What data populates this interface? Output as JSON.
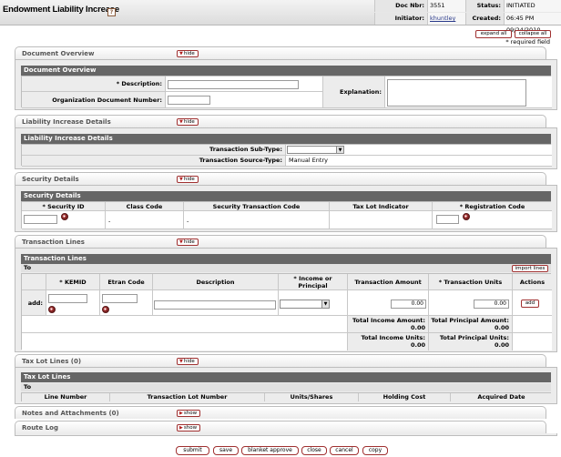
{
  "header": {
    "title": "Endowment Liability Increase",
    "help": "?",
    "doc_nbr_label": "Doc Nbr:",
    "doc_nbr": "3551",
    "status_label": "Status:",
    "status": "INITIATED",
    "initiator_label": "Initiator:",
    "initiator": "khuntley",
    "created_label": "Created:",
    "created": "06:45 PM 09/24/2010"
  },
  "actions": {
    "expand_all": "expand all",
    "collapse_all": "collapse all",
    "required_note": "* required field"
  },
  "document_overview": {
    "tab": "Document Overview",
    "toggle": "hide",
    "subheader": "Document Overview",
    "description_label": "* Description:",
    "org_doc_number_label": "Organization Document Number:",
    "explanation_label": "Explanation:"
  },
  "liability_details": {
    "tab": "Liability Increase Details",
    "toggle": "hide",
    "subheader": "Liability Increase Details",
    "sub_type_label": "Transaction Sub-Type:",
    "source_type_label": "Transaction Source-Type:",
    "source_type_value": "Manual Entry"
  },
  "security_details": {
    "tab": "Security Details",
    "toggle": "hide",
    "subheader": "Security Details",
    "columns": [
      "* Security ID",
      "Class Code",
      "Security Transaction Code",
      "Tax Lot Indicator",
      "* Registration Code"
    ],
    "class_code_value": "-",
    "transaction_code_value": "-"
  },
  "transaction_lines": {
    "tab": "Transaction Lines",
    "toggle": "hide",
    "subheader": "Transaction Lines",
    "to_label": "To",
    "import_lines": "import lines",
    "columns": [
      "* KEMID",
      "Etran Code",
      "Description",
      "* Income or Principal",
      "Transaction Amount",
      "* Transaction Units",
      "Actions"
    ],
    "add_row_label": "add:",
    "amount_value": "0.00",
    "units_value": "0.00",
    "add_button": "add",
    "total_income_amount_label": "Total Income Amount:",
    "total_income_amount": "0.00",
    "total_principal_amount_label": "Total Principal Amount:",
    "total_principal_amount": "0.00",
    "total_income_units_label": "Total Income Units:",
    "total_income_units": "0.00",
    "total_principal_units_label": "Total Principal Units:",
    "total_principal_units": "0.00"
  },
  "tax_lot_lines": {
    "tab": "Tax Lot Lines (0)",
    "toggle": "hide",
    "subheader": "Tax Lot Lines",
    "to_label": "To",
    "columns": [
      "Line Number",
      "Transaction Lot Number",
      "Units/Shares",
      "Holding Cost",
      "Acquired Date"
    ]
  },
  "notes": {
    "tab": "Notes and Attachments (0)",
    "toggle": "show"
  },
  "route_log": {
    "tab": "Route Log",
    "toggle": "show"
  },
  "footer": {
    "buttons": [
      "submit",
      "save",
      "blanket approve",
      "close",
      "cancel",
      "copy"
    ]
  }
}
